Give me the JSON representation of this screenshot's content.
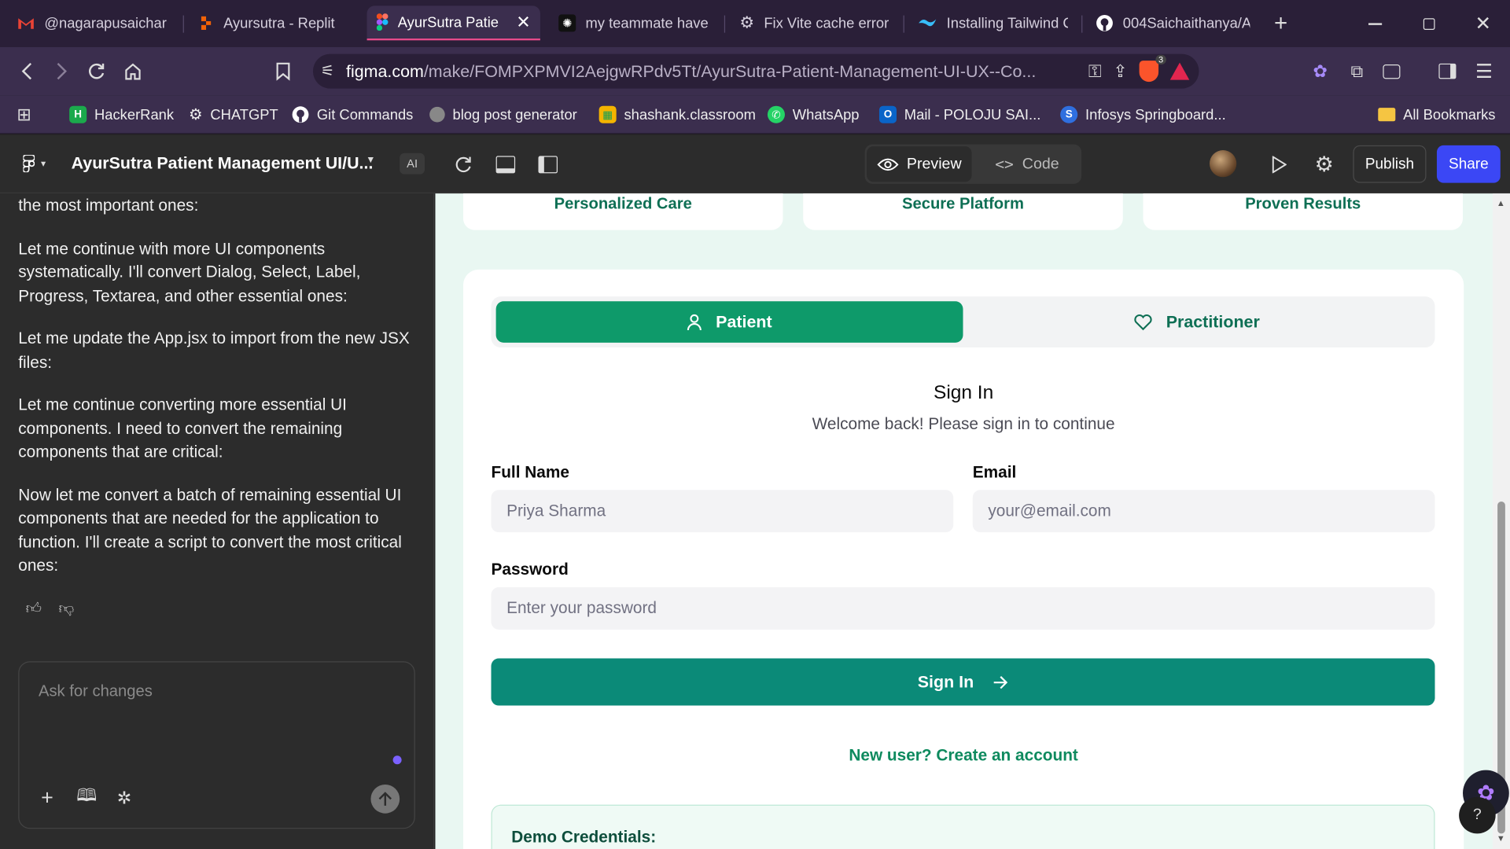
{
  "browser": {
    "tabs": [
      {
        "title": "@nagarapusaichar",
        "icon": "gmail-icon"
      },
      {
        "title": "Ayursutra - Replit",
        "icon": "replit-icon"
      },
      {
        "title": "AyurSutra Patie",
        "icon": "figma-icon",
        "active": true
      },
      {
        "title": "my teammate have",
        "icon": "openai-icon"
      },
      {
        "title": "Fix Vite cache error",
        "icon": "chatgpt-icon"
      },
      {
        "title": "Installing Tailwind C",
        "icon": "tailwind-icon"
      },
      {
        "title": "004Saichaithanya/A",
        "icon": "github-icon"
      }
    ],
    "url_domain": "figma.com",
    "url_path": "/make/FOMPXPMVI2AejgwRPdv5Tt/AyurSutra-Patient-Management-UI-UX--Co...",
    "brave_badge": "3",
    "bookmarks": [
      {
        "label": "HackerRank",
        "icon": "hackerrank-icon"
      },
      {
        "label": "CHATGPT",
        "icon": "chatgpt-icon"
      },
      {
        "label": "Git Commands",
        "icon": "github-icon"
      },
      {
        "label": "blog post generator",
        "icon": "globe-icon"
      },
      {
        "label": "shashank.classroom",
        "icon": "classroom-icon"
      },
      {
        "label": "WhatsApp",
        "icon": "whatsapp-icon"
      },
      {
        "label": "Mail - POLOJU SAI...",
        "icon": "outlook-icon"
      },
      {
        "label": "Infosys Springboard...",
        "icon": "infosys-icon"
      }
    ],
    "all_bookmarks": "All Bookmarks"
  },
  "figma": {
    "file_title": "AyurSutra Patient Management UI/U...",
    "ai_badge": "AI",
    "preview_label": "Preview",
    "code_label": "Code",
    "publish_label": "Publish",
    "share_label": "Share"
  },
  "chat": {
    "partial_line": "the most important ones:",
    "messages": [
      "Let me continue with more UI components systematically. I'll convert Dialog, Select, Label, Progress, Textarea, and other essential ones:",
      "Let me update the App.jsx to import from the new JSX files:",
      "Let me continue converting more essential UI components. I need to convert the remaining components that are critical:",
      "Now let me convert a batch of remaining essential UI components that are needed for the application to function. I'll create a script to convert the most critical ones:"
    ],
    "input_placeholder": "Ask for changes"
  },
  "app": {
    "feature_cards": [
      "Personalized Care",
      "Secure Platform",
      "Proven Results"
    ],
    "role_tabs": {
      "patient": "Patient",
      "practitioner": "Practitioner"
    },
    "heading": "Sign In",
    "subheading": "Welcome back! Please sign in to continue",
    "full_name_label": "Full Name",
    "full_name_placeholder": "Priya Sharma",
    "email_label": "Email",
    "email_placeholder": "your@email.com",
    "password_label": "Password",
    "password_placeholder": "Enter your password",
    "sign_in_button": "Sign In",
    "create_account_link": "New user? Create an account",
    "demo_title": "Demo Credentials:"
  },
  "colors": {
    "brand_green": "#0e9a6a",
    "figma_blue": "#3b47f5",
    "tab_accent": "#e64b8b"
  }
}
